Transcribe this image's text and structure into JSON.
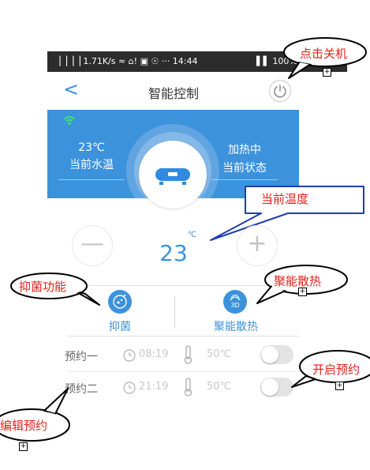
{
  "status_bar": {
    "left_text": "▕▕▕▕ 1.71K/s ≈ ⌂! ▣ ☉ ··· 14:44",
    "right_text": "▌▌ 100% █"
  },
  "header": {
    "title": "智能控制",
    "back_label": "<"
  },
  "panel": {
    "water_temp_value": "23℃",
    "water_temp_label": "当前水温",
    "state_value": "加热中",
    "state_label": "当前状态"
  },
  "temperature": {
    "value": "23",
    "unit": "℃",
    "minus_label": "—",
    "plus_label": "+"
  },
  "features": {
    "antibacterial_label": "抑菌",
    "heat_dissipation_label": "聚能散热",
    "heat_icon_text": "3D"
  },
  "schedules": [
    {
      "name": "预约一",
      "time": "08:19",
      "temp": "50℃",
      "enabled": false
    },
    {
      "name": "预约二",
      "time": "21:19",
      "temp": "50℃",
      "enabled": false
    }
  ],
  "callouts": {
    "power_off": "点击关机",
    "current_temp": "当前温度",
    "antibacterial": "抑菌功能",
    "heat": "聚能散热",
    "enable_schedule": "开启预约",
    "edit_schedule": "编辑预约"
  },
  "colors": {
    "accent": "#3d92dc",
    "callout_text": "#e8201a",
    "status_bar": "#2c2c2c"
  }
}
